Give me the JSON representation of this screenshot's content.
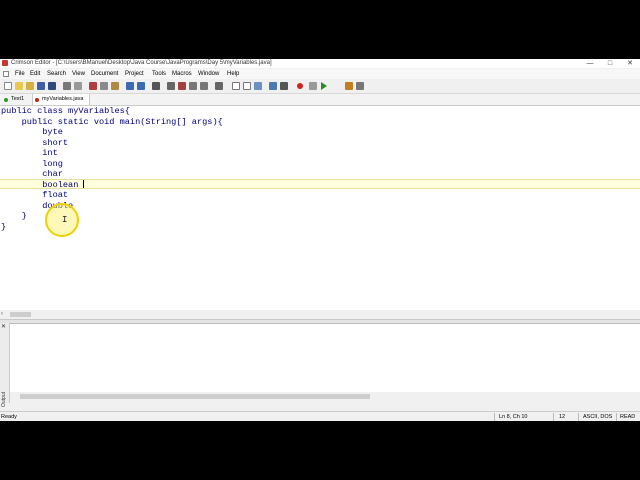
{
  "window": {
    "title": "Crimson Editor - [C:\\Users\\BManuel\\Desktop\\Java Course\\JavaPrograms\\Day 5\\myVariables.java]",
    "controls": {
      "minimize": "—",
      "maximize": "□",
      "close": "✕"
    }
  },
  "menu": [
    "File",
    "Edit",
    "Search",
    "View",
    "Document",
    "Project",
    "Tools",
    "Macros",
    "Window",
    "Help"
  ],
  "toolbar": {
    "icons": [
      "new-file-icon",
      "open-icon",
      "open-folder-icon",
      "save-icon",
      "save-all-icon",
      "print-icon",
      "print-preview-icon",
      "cut-icon",
      "copy-icon",
      "paste-icon",
      "undo-icon",
      "redo-icon",
      "find-icon",
      "find-next-icon",
      "replace-icon",
      "goto-icon",
      "goto-line-icon",
      "column-mode-icon",
      "word-wrap-icon",
      "split-window-icon",
      "toggle-output-icon",
      "settings-icon",
      "highlight-icon",
      "record-macro-icon",
      "pause-macro-icon",
      "play-macro-icon",
      "help-icon",
      "home-icon"
    ],
    "record_color": "#d02020",
    "play_color": "#2a8a2a"
  },
  "tabs": [
    {
      "label": "Text1",
      "dot_color": "#2a9a2a"
    },
    {
      "label": "myVariables.java",
      "dot_color": "#c02020"
    }
  ],
  "code": {
    "lines": [
      "public class myVariables{",
      "    public static void main(String[] args){",
      "        byte",
      "        short",
      "        int",
      "        long",
      "        char",
      "        boolean",
      "        float",
      "        double",
      "    }",
      "}"
    ],
    "current_line": 8,
    "text_color": "#000080"
  },
  "output": {
    "close_icon": "✕",
    "label": "Output"
  },
  "status": {
    "text": "Ready",
    "position": "Ln 8, Ch 10",
    "tab_size": "12",
    "encoding": "ASCII, DOS",
    "mode": "READ"
  }
}
